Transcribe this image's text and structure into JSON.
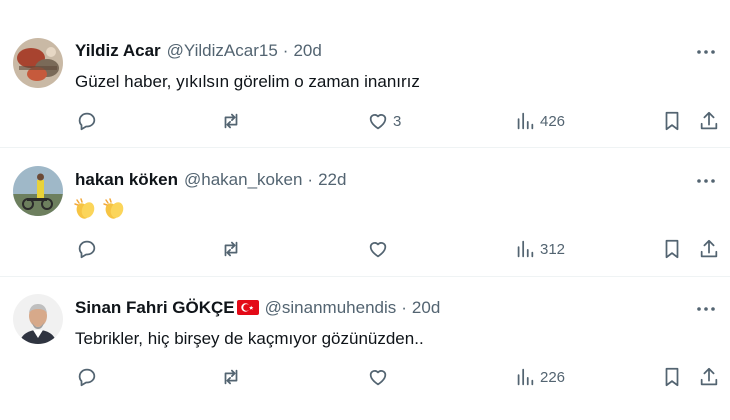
{
  "tweets": [
    {
      "name": "Yildiz Acar",
      "handle": "@YildizAcar15",
      "dot": "·",
      "time": "20d",
      "text": "Güzel haber, yıkılsın görelim o zaman inanırız",
      "likes": "3",
      "views": "426"
    },
    {
      "name": "hakan köken",
      "handle": "@hakan_koken",
      "dot": "·",
      "time": "22d",
      "text": "",
      "emoji": "clapping-hands-emoji",
      "likes": "",
      "views": "312"
    },
    {
      "name": "Sinan Fahri GÖKÇE",
      "handle": "@sinanmuhendis",
      "dot": "·",
      "time": "20d",
      "text": "Tebrikler, hiç birşey de kaçmıyor gözünüzden..",
      "flag": "turkey-flag-icon",
      "likes": "",
      "views": "226"
    }
  ],
  "colors": {
    "text": "#0f1419",
    "secondary": "#536471",
    "divider": "#eff3f4",
    "flag_red": "#e30a17"
  },
  "icons": [
    "reply-icon",
    "retweet-icon",
    "like-icon",
    "views-icon",
    "bookmark-icon",
    "share-icon",
    "more-icon"
  ]
}
